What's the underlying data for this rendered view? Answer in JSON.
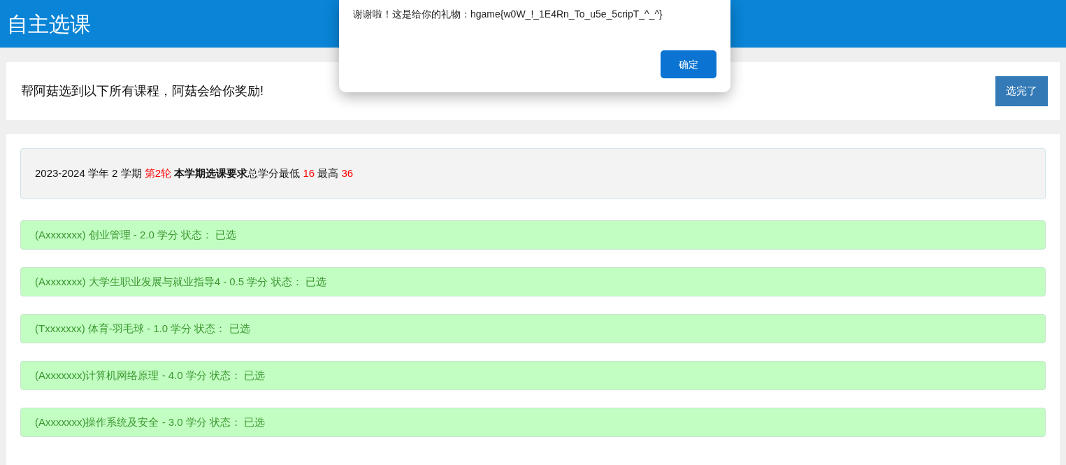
{
  "header": {
    "title": "自主选课"
  },
  "intro": {
    "text": "帮阿菇选到以下所有课程，阿菇会给你奖励!",
    "button": "选完了"
  },
  "semester": {
    "segments": [
      {
        "kind": "plain",
        "text": "2023-2024 学年 2 学期 "
      },
      {
        "kind": "red",
        "text": "第2轮"
      },
      {
        "kind": "bold",
        "text": " 本学期选课要求"
      },
      {
        "kind": "plain",
        "text": "总学分最低 "
      },
      {
        "kind": "red",
        "text": "16"
      },
      {
        "kind": "plain",
        "text": " 最高 "
      },
      {
        "kind": "red",
        "text": "36"
      }
    ]
  },
  "courses": [
    {
      "text": "(Axxxxxxx) 创业管理 - 2.0 学分 状态： 已选",
      "selected": true
    },
    {
      "text": "(Axxxxxxx) 大学生职业发展与就业指导4 - 0.5 学分 状态： 已选",
      "selected": true
    },
    {
      "text": "(Txxxxxxx) 体育-羽毛球 - 1.0 学分 状态： 已选",
      "selected": true
    },
    {
      "text": "(Axxxxxxx)计算机网络原理 - 4.0 学分 状态： 已选",
      "selected": true
    },
    {
      "text": "(Axxxxxxx)操作系统及安全 - 3.0 学分 状态： 已选",
      "selected": true
    }
  ],
  "dialog": {
    "message": "谢谢啦！这是给你的礼物：hgame{w0W_!_1E4Rn_To_u5e_5cripT_^_^}",
    "button": "确定"
  }
}
